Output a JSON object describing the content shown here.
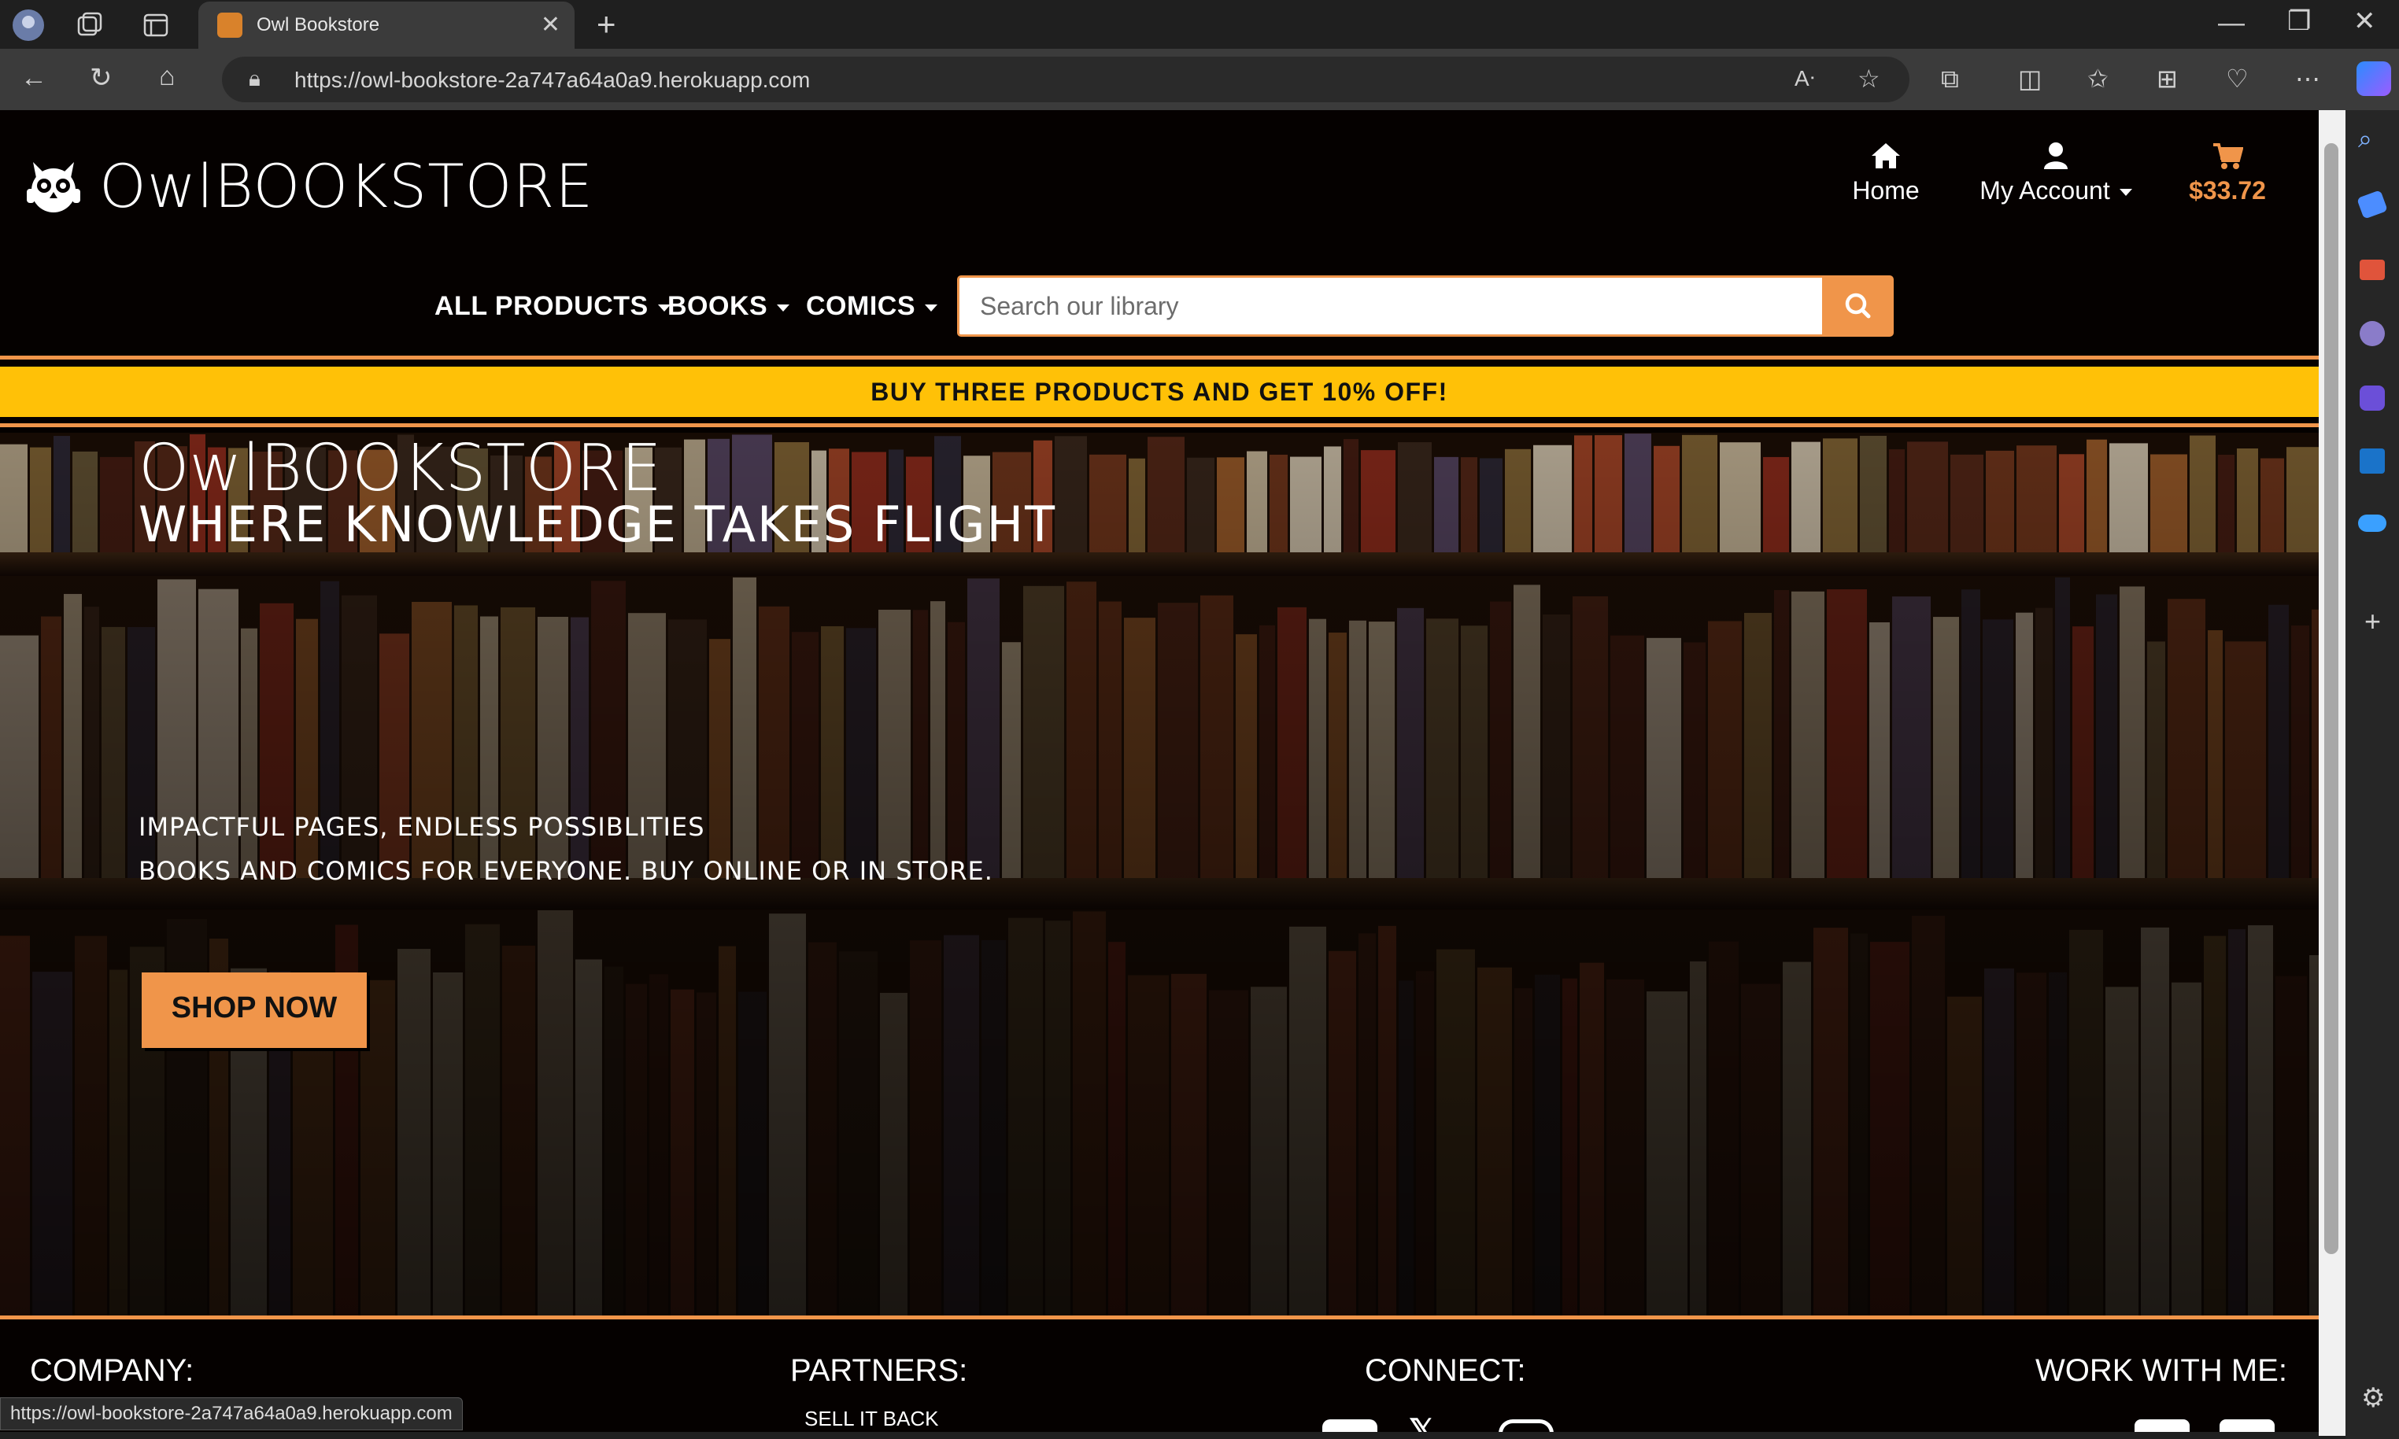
{
  "browser": {
    "tab_title": "Owl Bookstore",
    "url": "https://owl-bookstore-2a747a64a0a9.herokuapp.com",
    "status_url": "https://owl-bookstore-2a747a64a0a9.herokuapp.com"
  },
  "header": {
    "brand_light": "Owl",
    "brand_bold": "BOOKSTORE",
    "nav": {
      "home": "Home",
      "account": "My Account",
      "cart_total": "$33.72"
    },
    "categories": [
      "ALL PRODUCTS",
      "BOOKS",
      "COMICS"
    ],
    "search_placeholder": "Search our library"
  },
  "promo": "BUY THREE PRODUCTS AND GET 10% OFF!",
  "hero": {
    "title_light": "Owl",
    "title_bold": "BOOKSTORE",
    "tagline": "WHERE KNOWLEDGE TAKES FLIGHT",
    "sub1": "IMPACTFUL PAGES, ENDLESS POSSIBLITIES",
    "sub2": "BOOKS AND COMICS FOR EVERYONE. BUY ONLINE OR IN STORE.",
    "cta": "SHOP NOW"
  },
  "footer": {
    "company": "COMPANY:",
    "partners": "PARTNERS:",
    "partners_link": "SELL IT BACK",
    "connect": "CONNECT:",
    "work": "WORK WITH ME:"
  },
  "colors": {
    "accent": "#f0954a",
    "promo_bg": "#ffc107",
    "page_bg": "#050100"
  }
}
